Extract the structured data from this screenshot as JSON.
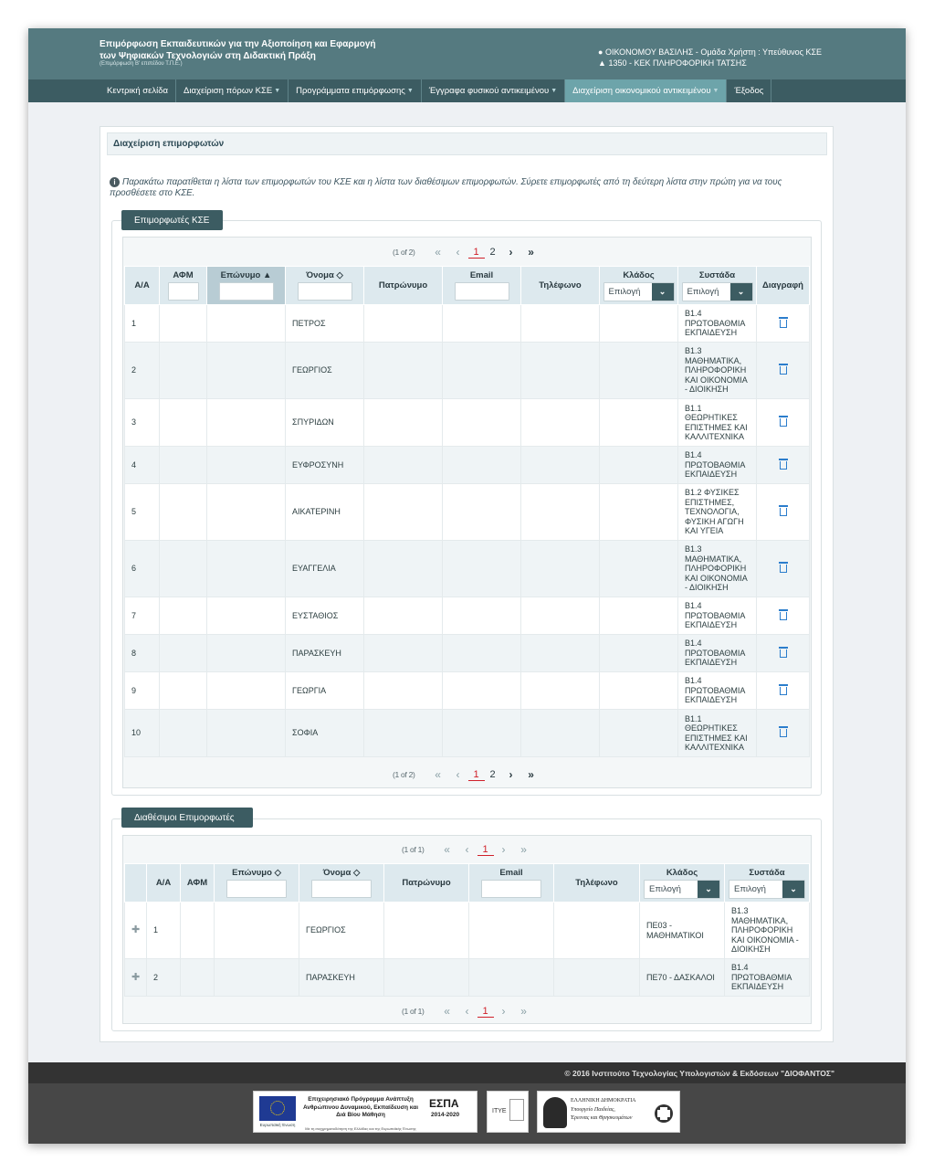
{
  "header": {
    "title_line1": "Επιμόρφωση Εκπαιδευτικών για την Αξιοποίηση και Εφαρμογή",
    "title_line2": "των Ψηφιακών Τεχνολογιών στη Διδακτική Πράξη",
    "subtitle": "(Επιμόρφωση Β' επιπέδου Τ.Π.Ε.)",
    "user": "ΟΙΚΟΝΟΜΟΥ ΒΑΣΙΛΗΣ - Ομάδα Χρήστη : Υπεύθυνος ΚΣΕ",
    "center": "1350 - ΚΕΚ ΠΛΗΡΟΦΟΡΙΚΗ ΤΑΤΣΗΣ"
  },
  "nav": [
    "Κεντρική σελίδα",
    "Διαχείριση πόρων ΚΣΕ",
    "Προγράμματα επιμόρφωσης",
    "Έγγραφα φυσικού αντικειμένου",
    "Διαχείριση οικονομικού αντικειμένου",
    "Έξοδος"
  ],
  "panel": {
    "title": "Διαχείριση επιμορφωτών",
    "info": "Παρακάτω παρατίθεται η λίστα των επιμορφωτών του ΚΣΕ και η λίστα των διαθέσιμων επιμορφωτών. Σύρετε επιμορφωτές από τη δεύτερη λίστα στην πρώτη για να τους προσθέσετε στο ΚΣΕ."
  },
  "kse": {
    "legend": "Επιμορφωτές ΚΣΕ",
    "pager": {
      "count": "(1 of 2)",
      "pages": [
        "1",
        "2"
      ],
      "current": "1"
    },
    "headers": {
      "aa": "Α/Α",
      "afm": "ΑΦΜ",
      "surname": "Επώνυμο",
      "name": "Όνομα",
      "patronymic": "Πατρώνυμο",
      "email": "Email",
      "phone": "Τηλέφωνο",
      "branch": "Κλάδος",
      "cluster": "Συστάδα",
      "delete": "Διαγραφή"
    },
    "select_placeholder": "Επιλογή",
    "rows": [
      {
        "aa": "1",
        "name": "ΠΕΤΡΟΣ",
        "cluster": "Β1.4 ΠΡΩΤΟΒΑΘΜΙΑ ΕΚΠΑΙΔΕΥΣΗ"
      },
      {
        "aa": "2",
        "name": "ΓΕΩΡΓΙΟΣ",
        "cluster": "Β1.3 ΜΑΘΗΜΑΤΙΚΑ, ΠΛΗΡΟΦΟΡΙΚΗ ΚΑΙ ΟΙΚΟΝΟΜΙΑ - ΔΙΟΙΚΗΣΗ"
      },
      {
        "aa": "3",
        "name": "ΣΠΥΡΙΔΩΝ",
        "cluster": "Β1.1 ΘΕΩΡΗΤΙΚΕΣ ΕΠΙΣΤΗΜΕΣ ΚΑΙ ΚΑΛΛΙΤΕΧΝΙΚΑ"
      },
      {
        "aa": "4",
        "name": "ΕΥΦΡΟΣΥΝΗ",
        "cluster": "Β1.4 ΠΡΩΤΟΒΑΘΜΙΑ ΕΚΠΑΙΔΕΥΣΗ"
      },
      {
        "aa": "5",
        "name": "ΑΙΚΑΤΕΡΙΝΗ",
        "cluster": "Β1.2 ΦΥΣΙΚΕΣ ΕΠΙΣΤΗΜΕΣ, ΤΕΧΝΟΛΟΓΙΑ, ΦΥΣΙΚΗ ΑΓΩΓΗ ΚΑΙ ΥΓΕΙΑ"
      },
      {
        "aa": "6",
        "name": "ΕΥΑΓΓΕΛΙΑ",
        "cluster": "Β1.3 ΜΑΘΗΜΑΤΙΚΑ, ΠΛΗΡΟΦΟΡΙΚΗ ΚΑΙ ΟΙΚΟΝΟΜΙΑ - ΔΙΟΙΚΗΣΗ"
      },
      {
        "aa": "7",
        "name": "ΕΥΣΤΑΘΙΟΣ",
        "cluster": "Β1.4 ΠΡΩΤΟΒΑΘΜΙΑ ΕΚΠΑΙΔΕΥΣΗ"
      },
      {
        "aa": "8",
        "name": "ΠΑΡΑΣΚΕΥΗ",
        "cluster": "Β1.4 ΠΡΩΤΟΒΑΘΜΙΑ ΕΚΠΑΙΔΕΥΣΗ"
      },
      {
        "aa": "9",
        "name": "ΓΕΩΡΓΙΑ",
        "cluster": "Β1.4 ΠΡΩΤΟΒΑΘΜΙΑ ΕΚΠΑΙΔΕΥΣΗ"
      },
      {
        "aa": "10",
        "name": "ΣΟΦΙΑ",
        "cluster": "Β1.1 ΘΕΩΡΗΤΙΚΕΣ ΕΠΙΣΤΗΜΕΣ ΚΑΙ ΚΑΛΛΙΤΕΧΝΙΚΑ"
      }
    ]
  },
  "available": {
    "legend": "Διαθέσιμοι Επιμορφωτές",
    "pager": {
      "count": "(1 of 1)",
      "pages": [
        "1"
      ],
      "current": "1"
    },
    "headers": {
      "aa": "Α/Α",
      "afm": "ΑΦΜ",
      "surname": "Επώνυμο",
      "name": "Όνομα",
      "patronymic": "Πατρώνυμο",
      "email": "Email",
      "phone": "Τηλέφωνο",
      "branch": "Κλάδος",
      "cluster": "Συστάδα"
    },
    "select_placeholder": "Επιλογή",
    "rows": [
      {
        "aa": "1",
        "name": "ΓΕΩΡΓΙΟΣ",
        "branch": "ΠΕ03 - ΜΑΘΗΜΑΤΙΚΟΙ",
        "cluster": "Β1.3 ΜΑΘΗΜΑΤΙΚΑ, ΠΛΗΡΟΦΟΡΙΚΗ ΚΑΙ ΟΙΚΟΝΟΜΙΑ - ΔΙΟΙΚΗΣΗ"
      },
      {
        "aa": "2",
        "name": "ΠΑΡΑΣΚΕΥΗ",
        "branch": "ΠΕ70 - ΔΑΣΚΑΛΟΙ",
        "cluster": "Β1.4 ΠΡΩΤΟΒΑΘΜΙΑ ΕΚΠΑΙΔΕΥΣΗ"
      }
    ]
  },
  "footer": {
    "copyright": "© 2016 Ινστιτούτο Τεχνολογίας Υπολογιστών & Εκδόσεων \"ΔΙΟΦΑΝΤΟΣ\"",
    "eu_label": "Ευρωπαϊκή Ένωση",
    "program": "Επιχειρησιακό Πρόγραμμα Ανάπτυξη Ανθρώπινου Δυναμικού, Εκπαίδευση και Διά Βίου Μάθηση",
    "program_sub": "Με τη συγχρηματοδότηση της Ελλάδας και της Ευρωπαϊκής Ένωσης",
    "espa": "ΕΣΠΑ",
    "espa_years": "2014-2020",
    "itye": "ΙΤΥΕ",
    "ministry_1": "ΕΛΛΗΝΙΚΗ ΔΗΜΟΚΡΑΤΙΑ",
    "ministry_2": "Υπουργείο Παιδείας,",
    "ministry_3": "Έρευνας και Θρησκευμάτων"
  }
}
